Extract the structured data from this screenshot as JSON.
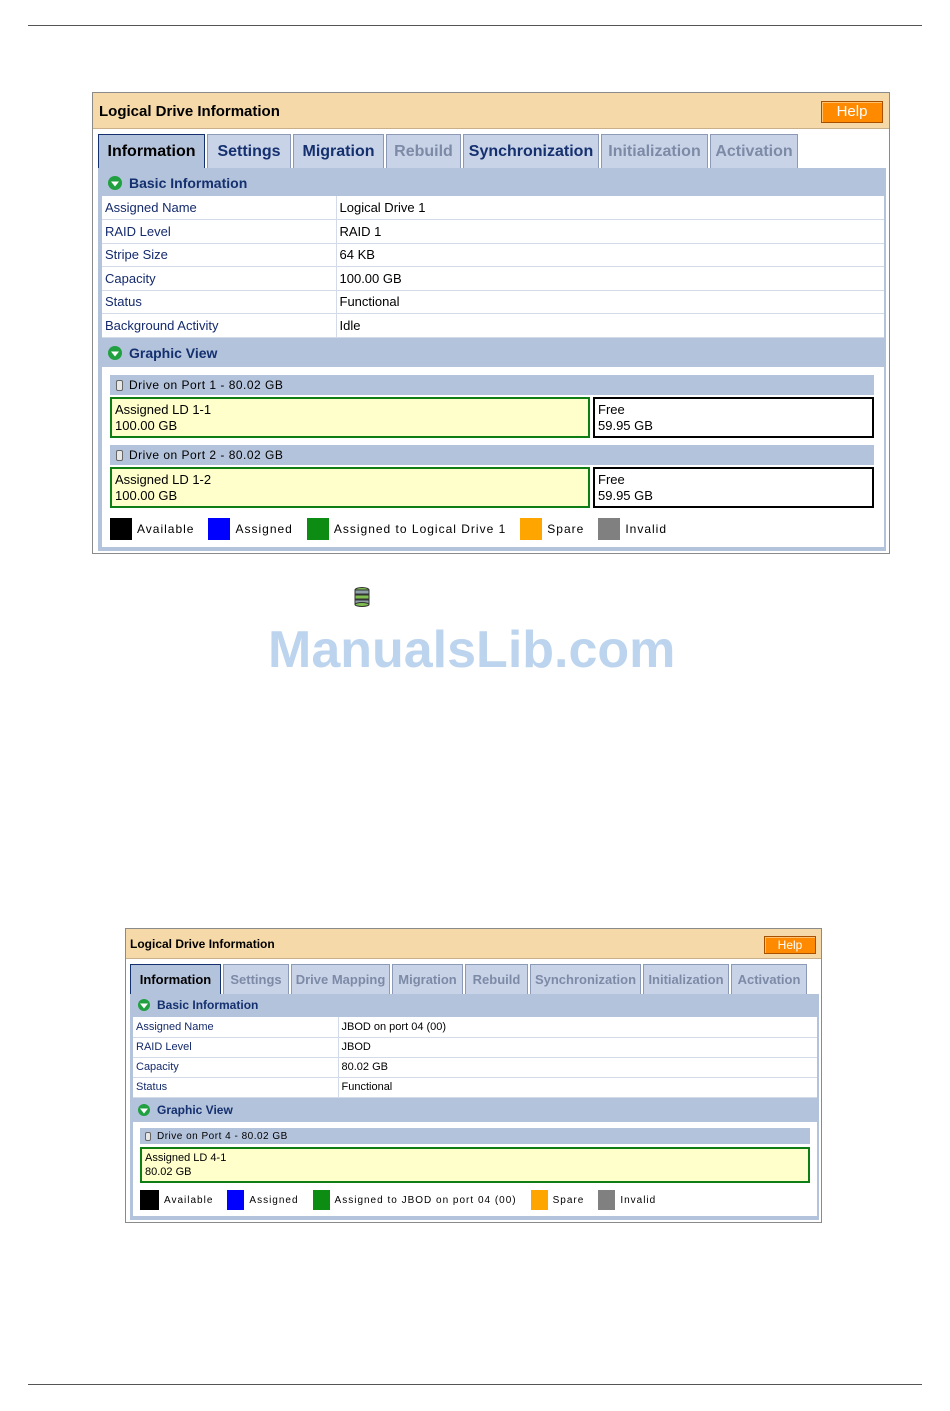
{
  "panel1": {
    "title": "Logical Drive Information",
    "help_label": "Help",
    "tabs": [
      {
        "label": "Information",
        "state": "active"
      },
      {
        "label": "Settings",
        "state": "enabled"
      },
      {
        "label": "Migration",
        "state": "enabled"
      },
      {
        "label": "Rebuild",
        "state": "disabled"
      },
      {
        "label": "Synchronization",
        "state": "enabled"
      },
      {
        "label": "Initialization",
        "state": "disabled"
      },
      {
        "label": "Activation",
        "state": "disabled"
      }
    ],
    "basic_info_title": "Basic Information",
    "rows": [
      {
        "label": "Assigned Name",
        "value": "Logical Drive 1"
      },
      {
        "label": "RAID Level",
        "value": "RAID 1"
      },
      {
        "label": "Stripe Size",
        "value": "64 KB"
      },
      {
        "label": "Capacity",
        "value": "100.00 GB"
      },
      {
        "label": "Status",
        "value": "Functional"
      },
      {
        "label": "Background Activity",
        "value": "Idle"
      }
    ],
    "graphic_view_title": "Graphic View",
    "drives": [
      {
        "header": "Drive on Port 1 - 80.02 GB",
        "assigned_name": "Assigned LD 1-1",
        "assigned_size": "100.00 GB",
        "free_name": "Free",
        "free_size": "59.95 GB"
      },
      {
        "header": "Drive on Port 2 - 80.02 GB",
        "assigned_name": "Assigned LD 1-2",
        "assigned_size": "100.00 GB",
        "free_name": "Free",
        "free_size": "59.95 GB"
      }
    ],
    "legend": [
      {
        "label": "Available",
        "color": "#000000"
      },
      {
        "label": "Assigned",
        "color": "#0000ff"
      },
      {
        "label": "Assigned to Logical Drive 1",
        "color": "#0d8c14"
      },
      {
        "label": "Spare",
        "color": "#ffa500"
      },
      {
        "label": "Invalid",
        "color": "#808080"
      }
    ]
  },
  "panel2": {
    "title": "Logical Drive Information",
    "help_label": "Help",
    "tabs": [
      {
        "label": "Information",
        "state": "active"
      },
      {
        "label": "Settings",
        "state": "disabled"
      },
      {
        "label": "Drive Mapping",
        "state": "disabled"
      },
      {
        "label": "Migration",
        "state": "disabled"
      },
      {
        "label": "Rebuild",
        "state": "disabled"
      },
      {
        "label": "Synchronization",
        "state": "disabled"
      },
      {
        "label": "Initialization",
        "state": "disabled"
      },
      {
        "label": "Activation",
        "state": "disabled"
      }
    ],
    "basic_info_title": "Basic Information",
    "rows": [
      {
        "label": "Assigned Name",
        "value": "JBOD on port 04 (00)"
      },
      {
        "label": "RAID Level",
        "value": "JBOD"
      },
      {
        "label": "Capacity",
        "value": "80.02 GB"
      },
      {
        "label": "Status",
        "value": "Functional"
      }
    ],
    "graphic_view_title": "Graphic View",
    "drives": [
      {
        "header": "Drive on Port 4 - 80.02 GB",
        "assigned_name": "Assigned LD 4-1",
        "assigned_size": "80.02 GB"
      }
    ],
    "legend": [
      {
        "label": "Available",
        "color": "#000000"
      },
      {
        "label": "Assigned",
        "color": "#0000ff"
      },
      {
        "label": "Assigned to JBOD on port 04 (00)",
        "color": "#0d8c14"
      },
      {
        "label": "Spare",
        "color": "#ffa500"
      },
      {
        "label": "Invalid",
        "color": "#808080"
      }
    ]
  },
  "page_icon": "database-icon",
  "watermark": "ManualsLib.com"
}
